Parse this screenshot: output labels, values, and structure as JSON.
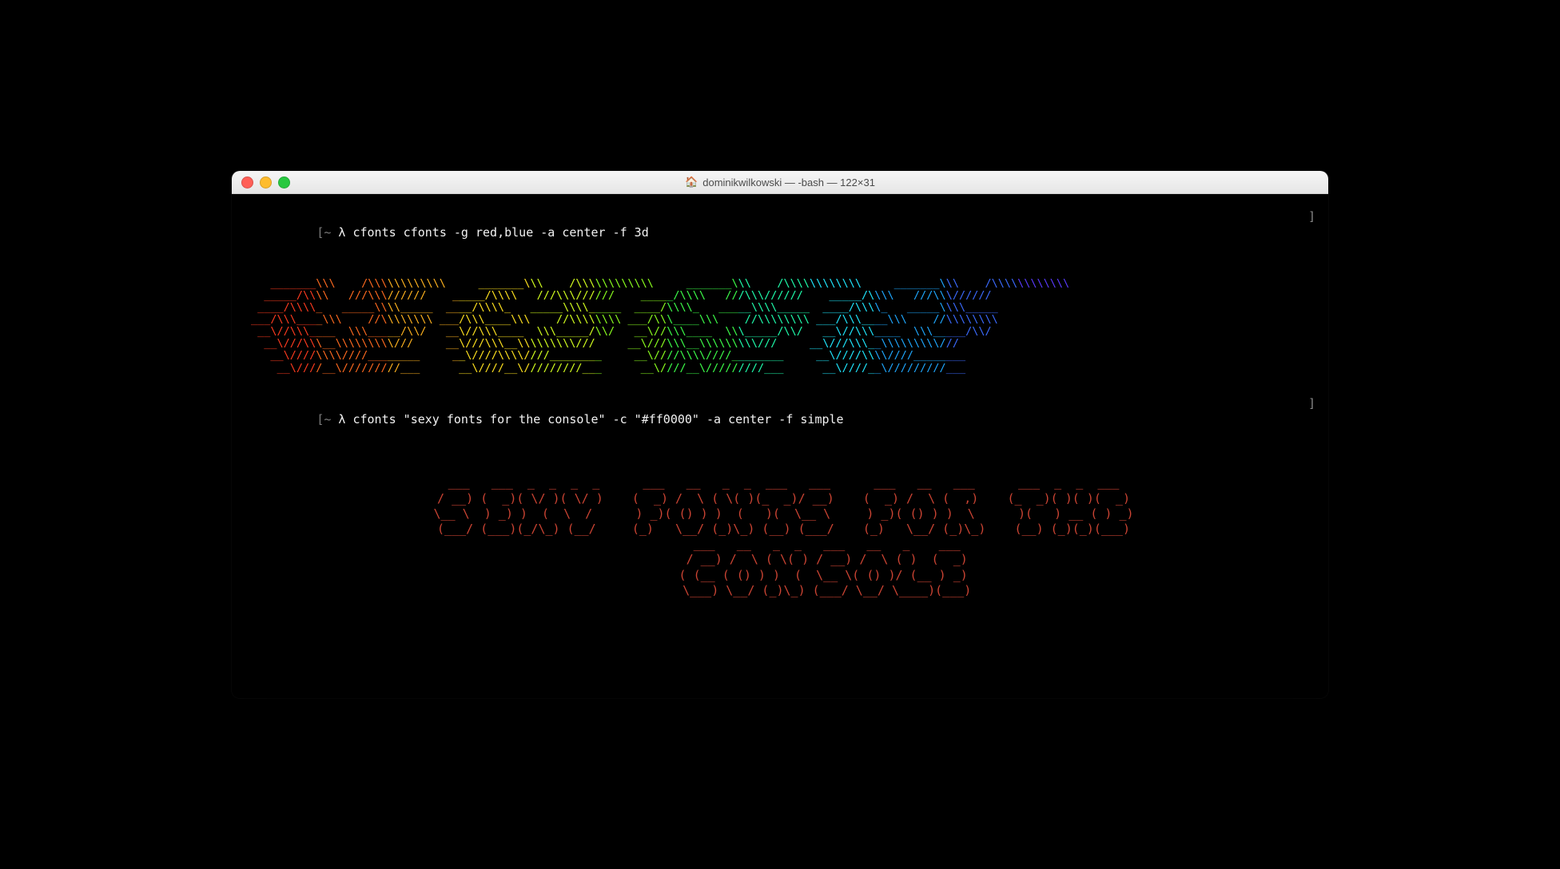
{
  "window": {
    "title": "dominikwilkowski — -bash — 122×31",
    "home_icon": "🏠"
  },
  "prompts": {
    "p1_prefix": "[~ ",
    "p1_lambda": "λ ",
    "p1_cmd": "cfonts cfonts -g red,blue -a center -f 3d",
    "p1_suffix": "]",
    "p2_prefix": "[~ ",
    "p2_lambda": "λ ",
    "p2_cmd": "cfonts \"sexy fonts for the console\" -c \"#ff0000\" -a center -f simple",
    "p2_suffix": "]"
  },
  "art3d": {
    "gradient": [
      "#ff3b1f",
      "#ff6a1f",
      "#ffb31f",
      "#ffe21f",
      "#d4ff1f",
      "#8cff1f",
      "#3dff4a",
      "#1fffad",
      "#1fe8ff",
      "#1fa8ff",
      "#3b6bff",
      "#5a3bff"
    ],
    "rows": [
      "   _______\\\\\\    /\\\\\\\\\\\\\\\\\\\\\\\\     _______\\\\\\    /\\\\\\\\\\\\\\\\\\\\\\\\     _______\\\\\\    /\\\\\\\\\\\\\\\\\\\\\\\\     _______\\\\\\    /\\\\\\\\\\\\\\\\\\\\\\\\   ",
      "  _____/\\\\\\\\   ///\\\\\\//////    _____/\\\\\\\\   ///\\\\\\//////    _____/\\\\\\\\   ///\\\\\\//////    _____/\\\\\\\\   ///\\\\\\//////   ",
      " ____/\\\\\\\\_   _____\\\\\\\\_____  ____/\\\\\\\\_   _____\\\\\\\\_____  ____/\\\\\\\\_   _____\\\\\\\\_____  ____/\\\\\\\\_   _____\\\\\\\\_____ ",
      "___/\\\\\\____\\\\\\    //\\\\\\\\\\\\\\\\ ___/\\\\\\____\\\\\\    //\\\\\\\\\\\\\\\\ ___/\\\\\\____\\\\\\    //\\\\\\\\\\\\\\\\ ___/\\\\\\____\\\\\\    //\\\\\\\\\\\\\\\\",
      " __\\//\\\\\\____  \\\\\\_____/\\\\/   __\\//\\\\\\____  \\\\\\_____/\\\\/   __\\//\\\\\\____  \\\\\\_____/\\\\/   __\\//\\\\\\____  \\\\\\_____/\\\\/ ",
      "  __\\///\\\\\\__\\\\\\\\\\\\\\\\\\///     __\\///\\\\\\__\\\\\\\\\\\\\\\\\\///     __\\///\\\\\\__\\\\\\\\\\\\\\\\\\///     __\\///\\\\\\__\\\\\\\\\\\\\\\\\\///   ",
      "   __\\////\\\\\\\\////________     __\\////\\\\\\\\////________     __\\////\\\\\\\\////________     __\\////\\\\\\\\////________  ",
      "    __\\////__\\/////////___      __\\////__\\/////////___      __\\////__\\/////////___      __\\////__\\/////////___  "
    ]
  },
  "simple_art": {
    "color": "#cc4433",
    "lines": [
      "  ___   ___  _  _  _  _      ___   __   _  _  ___   ___      ___   __   ___      ___  _  _  ___ ",
      " / __) (  _)( \\/ )( \\/ )    (  _) /  \\ ( \\( )(_  _)/ __)    (  _) /  \\ (  ,)    (_  _)( )( )(  _)",
      " \\__ \\  ) _) )  (  \\  /      ) _)( () ) )  (   )(  \\__ \\     ) _)( () ) )  \\      )(   ) __ ( ) _)",
      " (___/ (___)(_/\\_) (__/     (_)   \\__/ (_)\\_) (__) (___/    (_)   \\__/ (_)\\_)    (__) (_)(_)(___)",
      "",
      "              ___   __   _  _   ___   __   _    ___ ",
      "             / __) /  \\ ( \\( ) / __) /  \\ ( )  (  _)",
      "            ( (__ ( () ) )  (  \\__ \\( () )/ (__ ) _)",
      "             \\___) \\__/ (_)\\_) (___/ \\__/ \\____)(___)"
    ]
  }
}
